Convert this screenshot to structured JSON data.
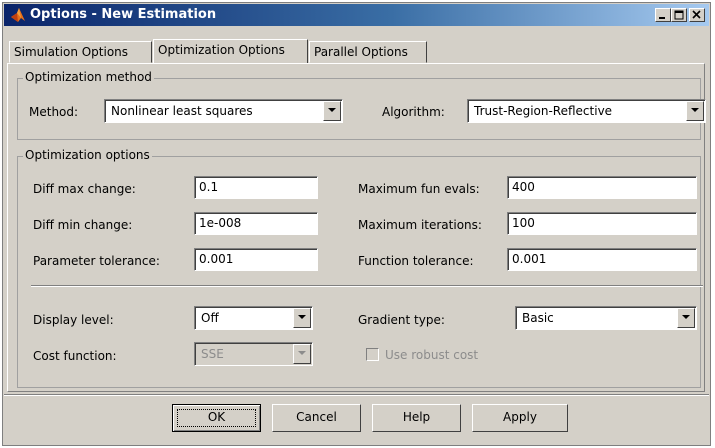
{
  "window": {
    "title": "Options - New Estimation",
    "icon": "matlab-icon",
    "controls": [
      "minimize-icon",
      "maximize-icon",
      "close-icon"
    ]
  },
  "tabs": [
    {
      "label": "Simulation Options",
      "active": false
    },
    {
      "label": "Optimization Options",
      "active": true
    },
    {
      "label": "Parallel Options",
      "active": false
    }
  ],
  "method_group": {
    "legend": "Optimization method",
    "method_label": "Method:",
    "method_value": "Nonlinear least squares",
    "algorithm_label": "Algorithm:",
    "algorithm_value": "Trust-Region-Reflective"
  },
  "options_group": {
    "legend": "Optimization options",
    "diff_max_change_label": "Diff max change:",
    "diff_max_change_value": "0.1",
    "diff_min_change_label": "Diff min change:",
    "diff_min_change_value": "1e-008",
    "parameter_tolerance_label": "Parameter tolerance:",
    "parameter_tolerance_value": "0.001",
    "max_fun_evals_label": "Maximum fun evals:",
    "max_fun_evals_value": "400",
    "max_iterations_label": "Maximum iterations:",
    "max_iterations_value": "100",
    "function_tolerance_label": "Function tolerance:",
    "function_tolerance_value": "0.001",
    "display_level_label": "Display level:",
    "display_level_value": "Off",
    "gradient_type_label": "Gradient type:",
    "gradient_type_value": "Basic",
    "cost_function_label": "Cost function:",
    "cost_function_value": "SSE",
    "robust_cost_label": "Use robust cost",
    "robust_cost_checked": false
  },
  "buttons": {
    "ok": "OK",
    "cancel": "Cancel",
    "help": "Help",
    "apply": "Apply"
  },
  "colors": {
    "dialog_bg": "#d4d0c8",
    "title_gradient_start": "#0a246a",
    "title_gradient_end": "#a6caf0",
    "disabled_text": "#8c8c8c"
  }
}
